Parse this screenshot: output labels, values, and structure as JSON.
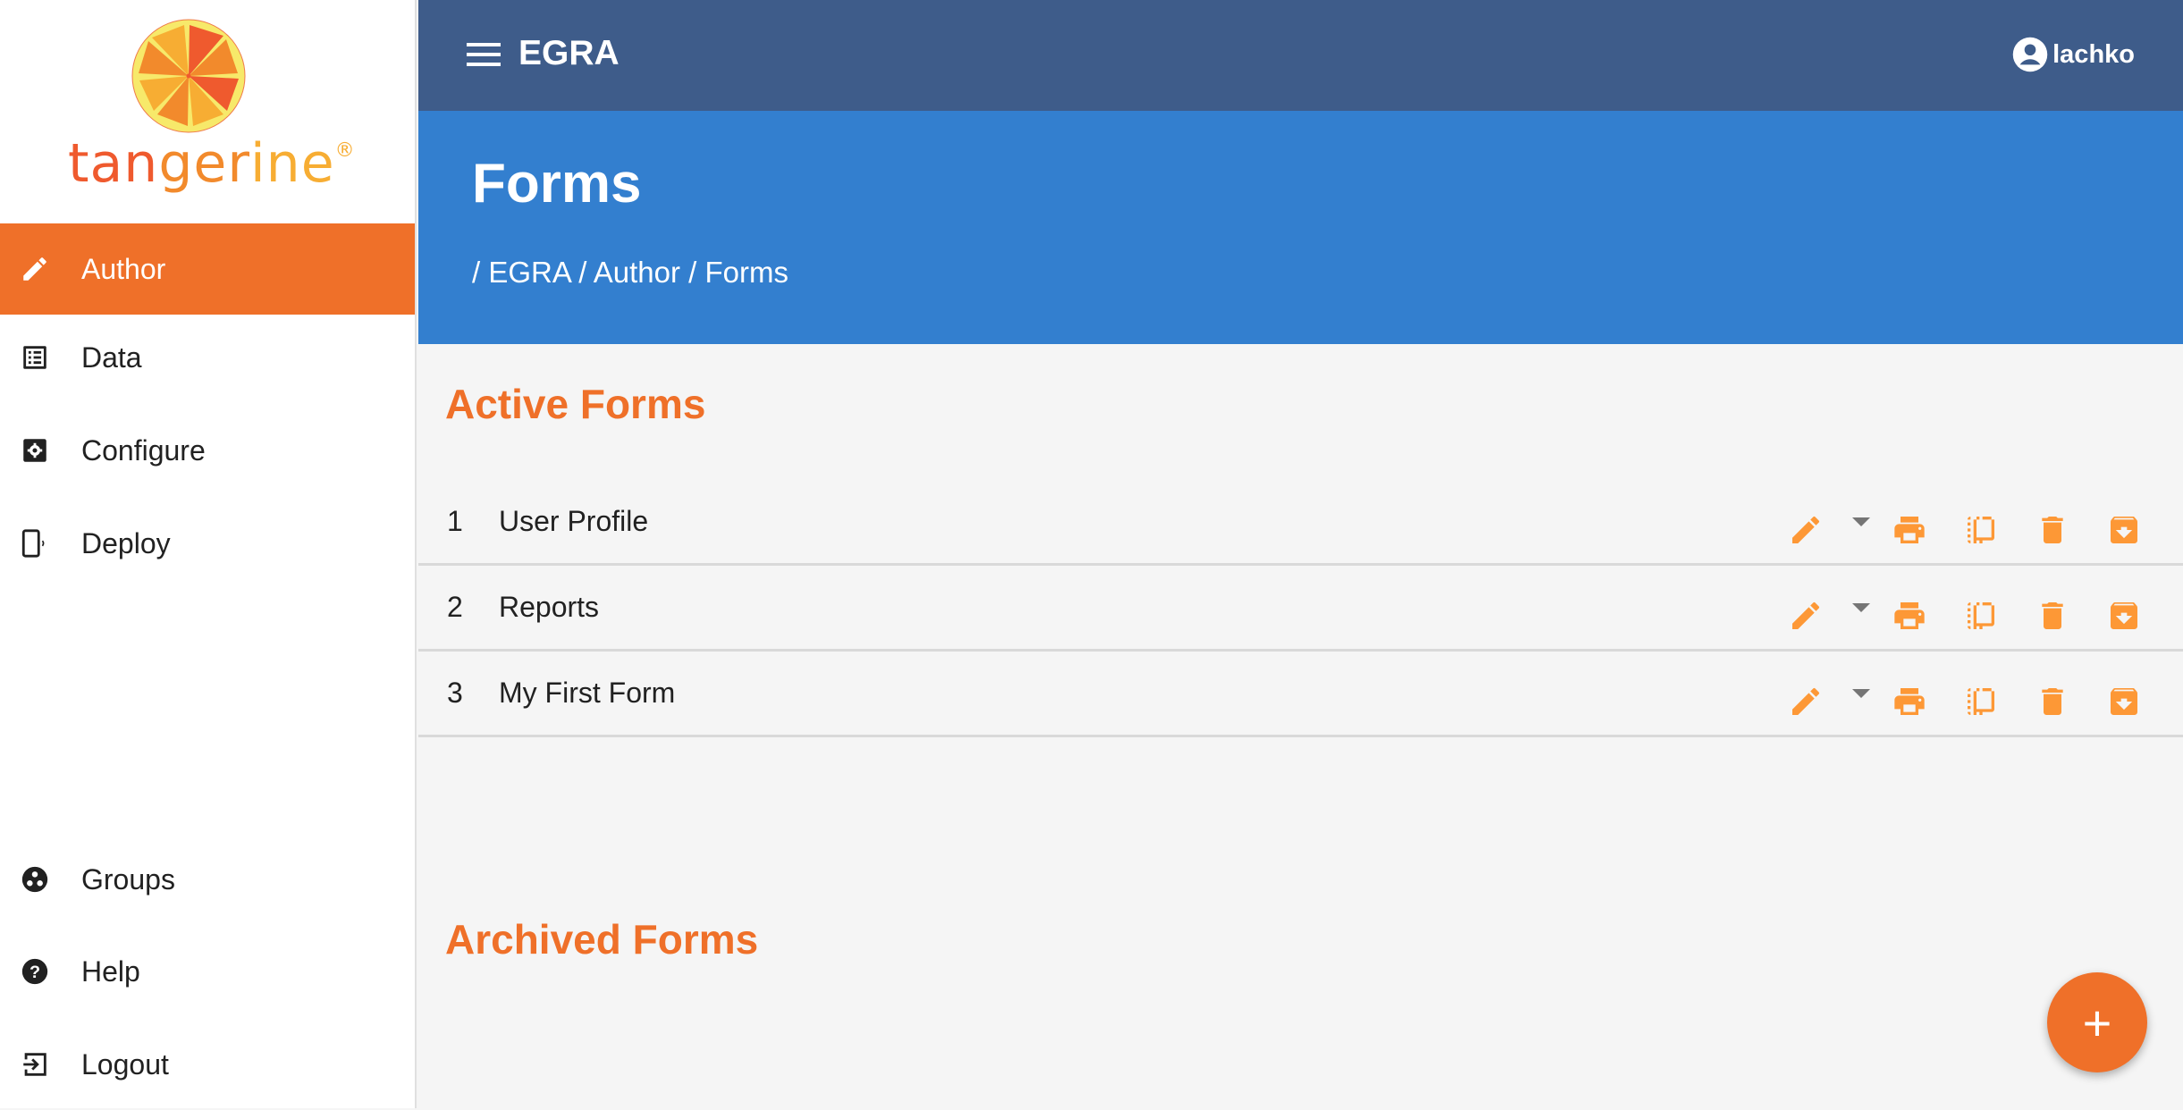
{
  "brand": {
    "logo_parts": [
      "tan",
      "ger",
      "ine"
    ],
    "registered": "®"
  },
  "sidebar": {
    "items": [
      {
        "label": "Author",
        "icon": "pencil-icon",
        "active": true
      },
      {
        "label": "Data",
        "icon": "list-icon",
        "active": false
      },
      {
        "label": "Configure",
        "icon": "settings-box-icon",
        "active": false
      },
      {
        "label": "Deploy",
        "icon": "phone-broadcast-icon",
        "active": false
      },
      {
        "label": "Groups",
        "icon": "groups-icon",
        "active": false
      },
      {
        "label": "Help",
        "icon": "help-icon",
        "active": false
      },
      {
        "label": "Logout",
        "icon": "logout-icon",
        "active": false
      }
    ]
  },
  "header": {
    "title": "EGRA",
    "user": "lachko"
  },
  "banner": {
    "title": "Forms",
    "breadcrumb": [
      "/ EGRA",
      "/ Author",
      "/ Forms"
    ]
  },
  "sections": {
    "active_title": "Active Forms",
    "archived_title": "Archived Forms"
  },
  "forms": [
    {
      "number": "1",
      "name": "User Profile"
    },
    {
      "number": "2",
      "name": "Reports"
    },
    {
      "number": "3",
      "name": "My First Form"
    }
  ],
  "row_actions": [
    "edit",
    "more-options",
    "print",
    "copy",
    "delete",
    "archive"
  ],
  "fab": {
    "label": "+"
  },
  "colors": {
    "accent": "#ef7029",
    "topbar": "#3e5c8a",
    "banner": "#337fcf",
    "action_icon": "#fd9836"
  }
}
